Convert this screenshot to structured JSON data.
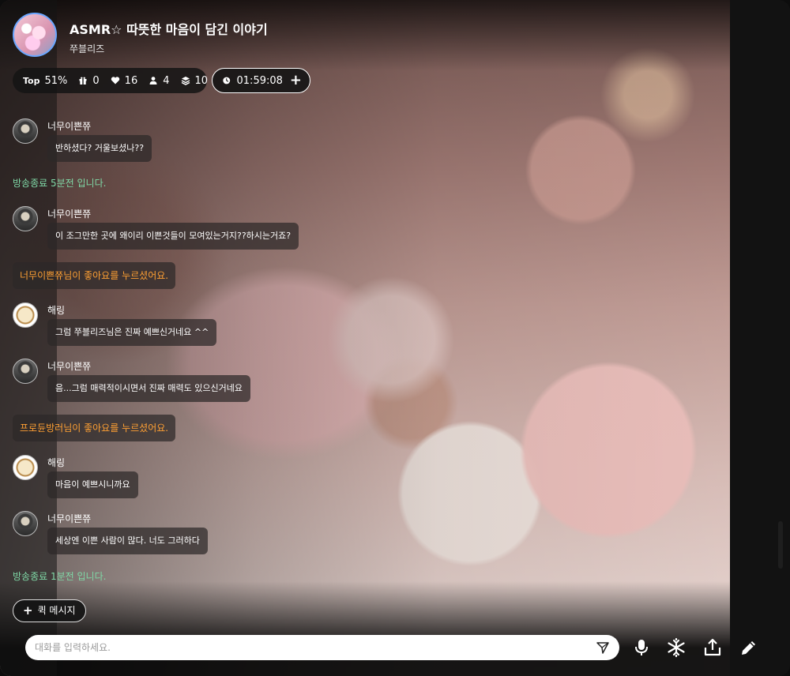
{
  "header": {
    "title": "ASMR☆ 따뜻한 마음이 담긴 이야기",
    "streamer": "쭈블리즈"
  },
  "stats": {
    "top_label": "Top",
    "top_percent": "51%",
    "gifts": "0",
    "likes": "16",
    "viewers": "4",
    "stack": "10"
  },
  "timer": {
    "time": "01:59:08",
    "plus": "+"
  },
  "chat": {
    "m1": {
      "nick": "너무이쁜쮸",
      "text": "반하셨다? 거울보셨나??"
    },
    "s1": "방송종료 5분전 입니다.",
    "m2": {
      "nick": "너무이쁜쮸",
      "text": "이 조그만한 곳에 왜이리 이쁜것들이 모여있는거지??하시는거죠?"
    },
    "l1": "너무이쁜쮸님이 좋아요를 누르셨어요.",
    "m3": {
      "nick": "해링",
      "text": "그럼 쭈블리즈님은 진짜 예쁘신거네요 ^^"
    },
    "m4": {
      "nick": "너무이쁜쮸",
      "text": "음...그럼 매력적이시면서 진짜 매력도 있으신거네요"
    },
    "l2": "프로듄방러님이 좋아요를 누르셨어요.",
    "m5": {
      "nick": "해링",
      "text": "마음이 예쁘시니까요"
    },
    "m6": {
      "nick": "너무이쁜쮸",
      "text": "세상엔 이쁜 사람이 많다. 너도 그러하다"
    },
    "s2": "방송종료 1분전 입니다."
  },
  "quick_message": {
    "plus": "+",
    "label": "퀵 메시지"
  },
  "input": {
    "placeholder": "대화를 입력하세요."
  },
  "icons": [
    "gift-icon",
    "heart-icon",
    "person-icon",
    "stack-icon",
    "clock-icon",
    "send-icon",
    "mic-icon",
    "snowflake-icon",
    "share-icon",
    "pencil-icon"
  ],
  "colors": {
    "system_green": "#7fd8a6",
    "like_orange": "#ffa033",
    "avatar_border": "#6aa6ff"
  }
}
